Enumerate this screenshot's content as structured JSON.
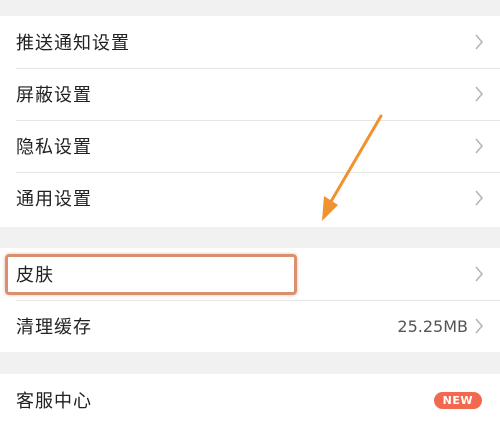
{
  "settings_group_1": {
    "items": [
      {
        "label": "推送通知设置"
      },
      {
        "label": "屏蔽设置"
      },
      {
        "label": "隐私设置"
      },
      {
        "label": "通用设置"
      }
    ]
  },
  "settings_group_2": {
    "items": [
      {
        "label": "皮肤"
      },
      {
        "label": "清理缓存",
        "value": "25.25MB"
      }
    ]
  },
  "settings_group_3": {
    "items": [
      {
        "label": "客服中心",
        "badge": "NEW"
      }
    ]
  },
  "colors": {
    "background": "#f1f1f1",
    "annotation_arrow": "#f0922e",
    "annotation_box": "#d9906f",
    "badge": "#f2694f"
  },
  "icons": {
    "chevron": "chevron-right-icon",
    "arrow": "annotation-arrow-icon"
  }
}
